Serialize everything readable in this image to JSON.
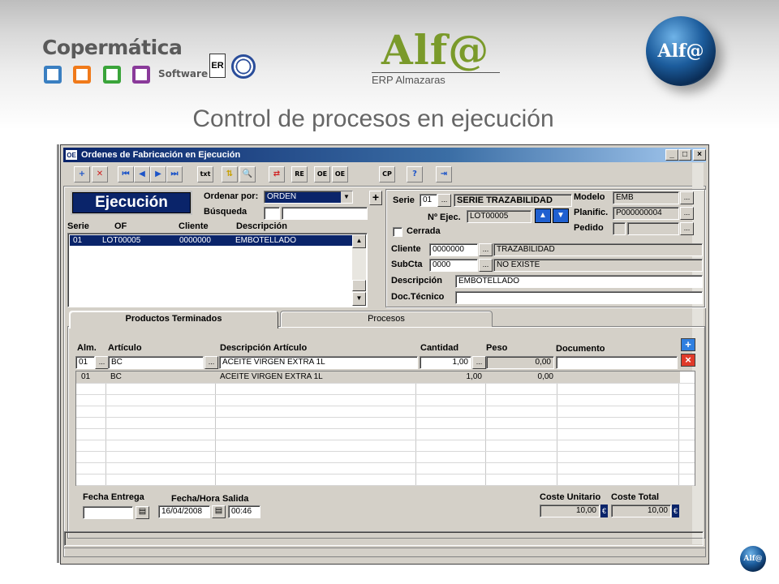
{
  "header": {
    "company_name": "Copermática",
    "company_sub": "Software",
    "cert_label": "ER",
    "product_logo": "Alf@",
    "product_sub": "ERP Almazaras",
    "badge_logo": "Alf@",
    "slide_title": "Control de procesos en ejecución",
    "square_colors": [
      "#3a7fc1",
      "#f07a1a",
      "#3aa43a",
      "#8a3a9a"
    ]
  },
  "window": {
    "icon": "OE",
    "title": "Ordenes de Fabricación en Ejecución",
    "controls": [
      "_",
      "□",
      "×"
    ]
  },
  "toolbar": {
    "buttons": [
      {
        "name": "add-icon",
        "glyph": "+",
        "color": "#1c54c8"
      },
      {
        "name": "delete-icon",
        "glyph": "✕",
        "color": "#d02020"
      },
      {
        "name": "first-record-icon",
        "glyph": "⏮",
        "color": "#1c54c8"
      },
      {
        "name": "previous-record-icon",
        "glyph": "◀",
        "color": "#1c54c8"
      },
      {
        "name": "next-record-icon",
        "glyph": "▶",
        "color": "#1c54c8"
      },
      {
        "name": "last-record-icon",
        "glyph": "⏭",
        "color": "#1c54c8"
      },
      {
        "name": "txt-export-icon",
        "glyph": "txt",
        "color": "#000"
      },
      {
        "name": "filter-icon",
        "glyph": "⇅",
        "color": "#c8a000"
      },
      {
        "name": "search-icon",
        "glyph": "🔍",
        "color": "#1c54c8"
      },
      {
        "name": "refresh-icon",
        "glyph": "⇄",
        "color": "#d02020"
      },
      {
        "name": "report-icon",
        "glyph": "RE",
        "color": "#000"
      },
      {
        "name": "order-icon",
        "glyph": "OE",
        "color": "#000"
      },
      {
        "name": "order-copy-icon",
        "glyph": "OE",
        "color": "#000"
      },
      {
        "name": "cp-icon",
        "glyph": "CP",
        "color": "#000"
      },
      {
        "name": "help-icon",
        "glyph": "?",
        "color": "#1c54c8"
      },
      {
        "name": "exit-icon",
        "glyph": "⇥",
        "color": "#1c54c8"
      }
    ]
  },
  "left_panel": {
    "status_label": "Ejecución",
    "order_by_label": "Ordenar por:",
    "order_by_value": "ORDEN",
    "search_label": "Búsqueda",
    "search_value": "",
    "add_button": "+",
    "columns": [
      "Serie",
      "OF",
      "Cliente",
      "Descripción"
    ],
    "rows": [
      {
        "serie": "01",
        "of": "LOT00005",
        "cliente": "0000000",
        "descripcion": "EMBOTELLADO"
      }
    ]
  },
  "detail": {
    "serie_label": "Serie",
    "serie_code": "01",
    "serie_name": "SERIE TRAZABILIDAD",
    "nejec_label": "Nº Ejec.",
    "nejec_value": "LOT00005",
    "cerrada_label": "Cerrada",
    "modelo_label": "Modelo",
    "modelo_value": "EMB",
    "planific_label": "Planific.",
    "planific_value": "P000000004",
    "pedido_label": "Pedido",
    "pedido_value": "",
    "cliente_label": "Cliente",
    "cliente_code": "0000000",
    "cliente_name": "TRAZABILIDAD",
    "subcta_label": "SubCta",
    "subcta_code": "0000",
    "subcta_name": "NO EXISTE",
    "descripcion_label": "Descripción",
    "descripcion_value": "EMBOTELLADO",
    "doctecnico_label": "Doc.Técnico",
    "doctecnico_value": "",
    "dots": "..."
  },
  "tabs": [
    "Productos Terminados",
    "Procesos"
  ],
  "products": {
    "columns": [
      "Alm.",
      "Artículo",
      "Descripción Artículo",
      "Cantidad",
      "Peso",
      "Documento"
    ],
    "edit_row": {
      "alm": "01",
      "articulo": "BC",
      "descripcion": "ACEITE VIRGEN EXTRA 1L",
      "cantidad": "1,00",
      "peso": "0,00",
      "documento": ""
    },
    "rows": [
      {
        "alm": "01",
        "articulo": "BC",
        "descripcion": "ACEITE VIRGEN EXTRA 1L",
        "cantidad": "1,00",
        "peso": "0,00"
      }
    ]
  },
  "footer": {
    "fecha_entrega_label": "Fecha Entrega",
    "fecha_entrega_value": "",
    "fecha_salida_label": "Fecha/Hora Salida",
    "fecha_salida_value": "16/04/2008",
    "hora_salida_value": "00:46",
    "coste_unitario_label": "Coste Unitario",
    "coste_unitario_value": "10,00",
    "coste_total_label": "Coste Total",
    "coste_total_value": "10,00",
    "currency": "€"
  }
}
